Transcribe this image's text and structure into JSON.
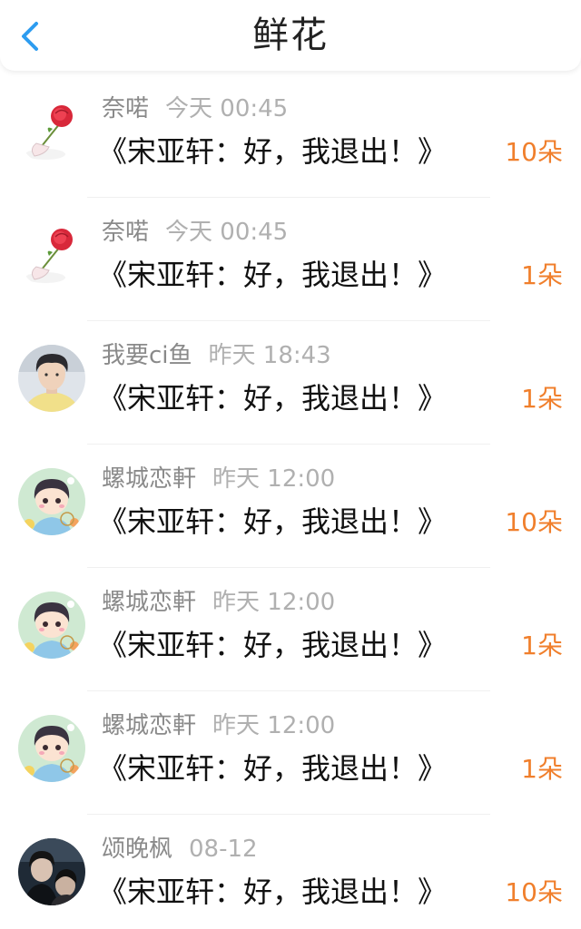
{
  "header": {
    "title": "鲜花",
    "back_icon": "chevron-left-icon",
    "accent_color": "#2d9cf0"
  },
  "count_color": "#f07f2c",
  "gifts": [
    {
      "name": "奈喏",
      "time": "今天 00:45",
      "title": "《宋亚轩：好，我退出！》",
      "count": "10朵",
      "avatar": "rose-icon"
    },
    {
      "name": "奈喏",
      "time": "今天 00:45",
      "title": "《宋亚轩：好，我退出！》",
      "count": "1朵",
      "avatar": "rose-icon"
    },
    {
      "name": "我要ci鱼",
      "time": "昨天 18:43",
      "title": "《宋亚轩：好，我退出！》",
      "count": "1朵",
      "avatar": "photo-avatar"
    },
    {
      "name": "螺城恋軒",
      "time": "昨天 12:00",
      "title": "《宋亚轩：好，我退出！》",
      "count": "10朵",
      "avatar": "cartoon-avatar"
    },
    {
      "name": "螺城恋軒",
      "time": "昨天 12:00",
      "title": "《宋亚轩：好，我退出！》",
      "count": "1朵",
      "avatar": "cartoon-avatar"
    },
    {
      "name": "螺城恋軒",
      "time": "昨天 12:00",
      "title": "《宋亚轩：好，我退出！》",
      "count": "1朵",
      "avatar": "cartoon-avatar"
    },
    {
      "name": "颂晚枫",
      "time": "08-12",
      "title": "《宋亚轩：好，我退出！》",
      "count": "10朵",
      "avatar": "dark-photo-avatar"
    }
  ]
}
